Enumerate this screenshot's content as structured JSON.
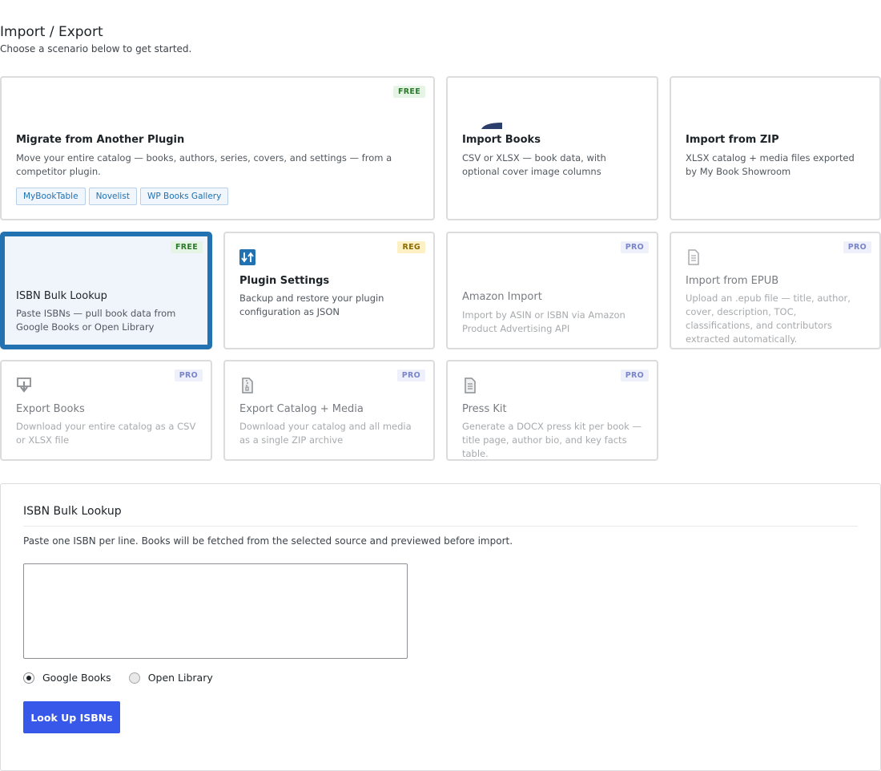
{
  "page": {
    "title": "Import / Export",
    "subtitle": "Choose a scenario below to get started."
  },
  "cards": {
    "migrate": {
      "title": "Migrate from Another Plugin",
      "description": "Move your entire catalog — books, authors, series, covers, and settings — from a competitor plugin.",
      "badge": "FREE",
      "chips": [
        "MyBookTable",
        "Novelist",
        "WP Books Gallery"
      ]
    },
    "import_books": {
      "title": "Import Books",
      "description": "CSV or XLSX — book data, with optional cover image columns"
    },
    "import_zip": {
      "title": "Import from ZIP",
      "description": "XLSX catalog + media files exported by My Book Showroom"
    },
    "isbn_lookup": {
      "title": "ISBN Bulk Lookup",
      "description": "Paste ISBNs — pull book data from Google Books or Open Library",
      "badge": "FREE"
    },
    "plugin_settings": {
      "title": "Plugin Settings",
      "description": "Backup and restore your plugin configuration as JSON",
      "badge": "REG",
      "icon": "sort-arrows-icon"
    },
    "amazon_import": {
      "title": "Amazon Import",
      "description": "Import by ASIN or ISBN via Amazon Product Advertising API",
      "badge": "PRO"
    },
    "import_epub": {
      "title": "Import from EPUB",
      "description": "Upload an .epub file — title, author, cover, description, TOC, classifications, and contributors extracted automatically.",
      "badge": "PRO",
      "icon": "document-icon"
    },
    "export_books": {
      "title": "Export Books",
      "description": "Download your entire catalog as a CSV or XLSX file",
      "badge": "PRO",
      "icon": "download-icon"
    },
    "export_catalog": {
      "title": "Export Catalog + Media",
      "description": "Download your catalog and all media as a single ZIP archive",
      "badge": "PRO",
      "icon": "zip-file-icon"
    },
    "press_kit": {
      "title": "Press Kit",
      "description": "Generate a DOCX press kit per book — title page, author bio, and key facts table.",
      "badge": "PRO",
      "icon": "document-icon"
    }
  },
  "panel": {
    "title": "ISBN Bulk Lookup",
    "description": "Paste one ISBN per line. Books will be fetched from the selected source and previewed before import.",
    "textarea_value": "",
    "sources": [
      {
        "label": "Google Books",
        "checked": true
      },
      {
        "label": "Open Library",
        "checked": false
      }
    ],
    "submit_label": "Look Up ISBNs"
  },
  "colors": {
    "accent": "#2271b1",
    "primary_button": "#3858e9",
    "free_badge": "#2b7a2b",
    "reg_badge": "#8a6d00",
    "pro_badge": "#7a86c8"
  }
}
